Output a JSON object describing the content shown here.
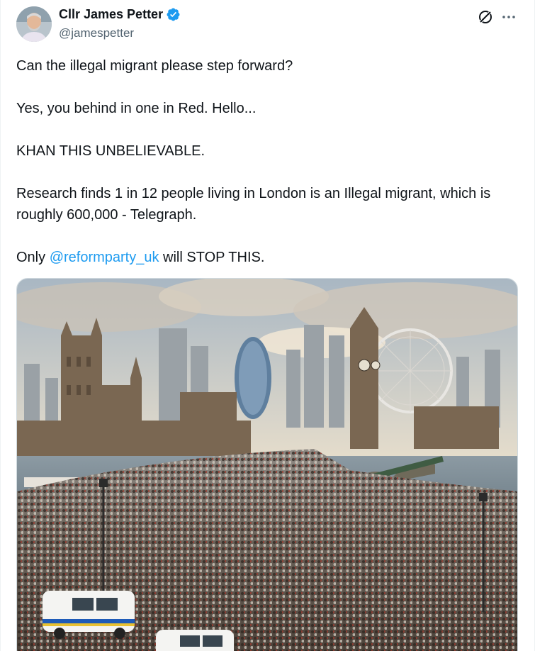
{
  "author": {
    "display_name": "Cllr James Petter",
    "handle": "@jamespetter",
    "verified": true,
    "verified_color": "#1d9bf0"
  },
  "tweet": {
    "line1": "Can the illegal migrant please step forward?",
    "line2": "Yes, you behind in one in Red. Hello...",
    "line3": "KHAN THIS UNBELIEVABLE.",
    "line4": "Research finds 1 in 12 people living in London is an Illegal migrant, which is roughly 600,000 - Telegraph.",
    "line5_pre": "Only ",
    "mention": "@reformparty_uk",
    "line5_post": " will STOP THIS."
  },
  "icons": {
    "grok": "grok-icon",
    "more": "more-icon",
    "verified": "verified-badge-icon"
  },
  "colors": {
    "text": "#0f1419",
    "secondary": "#536471",
    "link": "#1d9bf0"
  }
}
